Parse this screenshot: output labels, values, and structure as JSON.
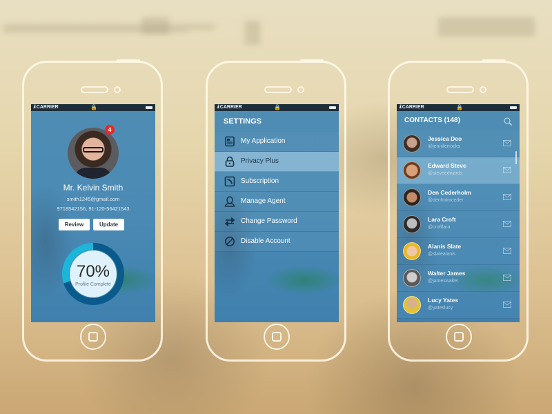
{
  "status_bar": {
    "carrier": "CARRIER",
    "signal_icon": "signal-bars",
    "lock_icon": "lock",
    "battery_icon": "battery"
  },
  "profile": {
    "notification_count": "4",
    "name": "Mr. Kelvin Smith",
    "email": "smith1245@gmail.com",
    "phones": "9718542156, 91-120-56421543",
    "buttons": {
      "review": "Review",
      "update": "Update"
    },
    "progress": {
      "percent": 70,
      "label": "70%",
      "caption": "Profile Complete"
    },
    "colors": {
      "ring_fill": "#0b5a8c",
      "ring_rest": "#1bb6d9",
      "ring_center": "#dff2fb"
    }
  },
  "settings": {
    "title": "SETTINGS",
    "items": [
      {
        "label": "My Application",
        "icon": "document-icon",
        "active": false
      },
      {
        "label": "Privacy Plus",
        "icon": "padlock-icon",
        "active": true
      },
      {
        "label": "Subscription",
        "icon": "rss-icon",
        "active": false
      },
      {
        "label": "Manage Agent",
        "icon": "user-icon",
        "active": false
      },
      {
        "label": "Change Password",
        "icon": "swap-arrows-icon",
        "active": false
      },
      {
        "label": "Disable Account",
        "icon": "block-icon",
        "active": false
      }
    ]
  },
  "contacts": {
    "title": "CONTACTS (148)",
    "search_icon": "search",
    "items": [
      {
        "name": "Jessica Deo",
        "handle": "@jenniferrocks",
        "active": false
      },
      {
        "name": "Edward Steve",
        "handle": "@steveedwards",
        "active": true
      },
      {
        "name": "Den Cederholm",
        "handle": "@denholmceder",
        "active": false
      },
      {
        "name": "Lara Croft",
        "handle": "@croftlara",
        "active": false
      },
      {
        "name": "Alanis Slate",
        "handle": "@slatealanis",
        "active": false
      },
      {
        "name": "Walter James",
        "handle": "@jameswalter",
        "active": false
      },
      {
        "name": "Lucy Yates",
        "handle": "@yateslucy",
        "active": false
      }
    ]
  }
}
